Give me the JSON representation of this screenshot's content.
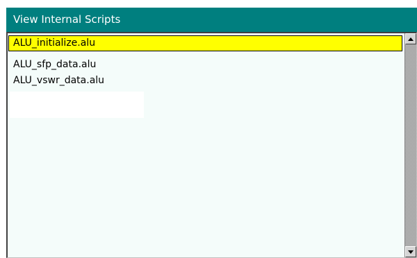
{
  "window": {
    "title": "View Internal Scripts"
  },
  "script_list": {
    "selected_index": 0,
    "items": [
      {
        "label": "ALU_initialize.alu"
      },
      {
        "label": "ALU_sfp_data.alu"
      },
      {
        "label": "ALU_vswr_data.alu"
      }
    ]
  },
  "scrollbar": {
    "up_icon": "triangle-up-icon",
    "down_icon": "triangle-down-icon"
  },
  "colors": {
    "title_bar": "#007f7f",
    "title_text": "#ffffff",
    "list_background": "#f4fcfa",
    "selection_highlight": "#ffff00"
  }
}
